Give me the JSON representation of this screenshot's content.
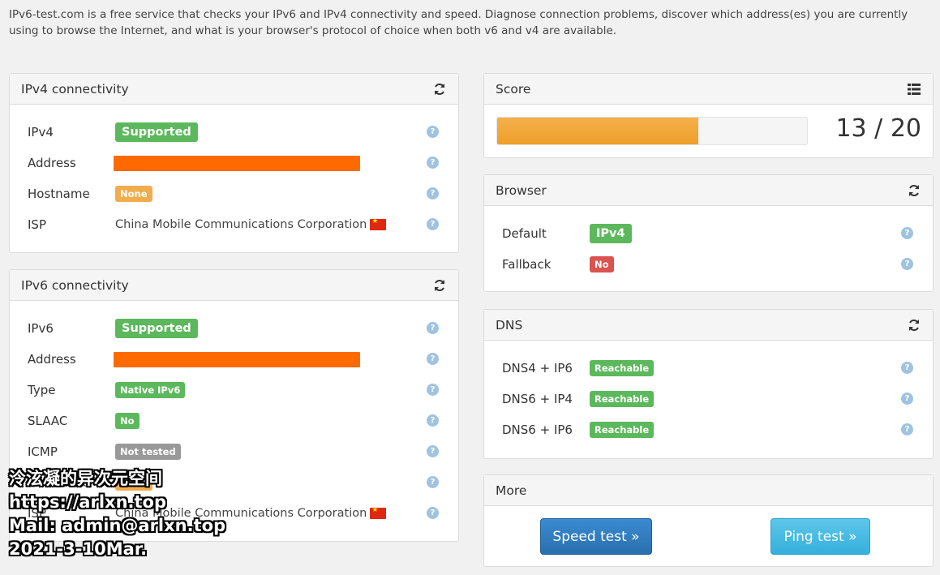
{
  "intro": "IPv6-test.com is a free service that checks your IPv6 and IPv4 connectivity and speed. Diagnose connection problems, discover which address(es) you are currently using to browse the Internet, and what is your browser's protocol of choice when both v6 and v4 are available.",
  "ipv4": {
    "title": "IPv4 connectivity",
    "refresh_icon": "refresh-icon",
    "rows": [
      {
        "label": "IPv4",
        "value": "Supported"
      },
      {
        "label": "Address",
        "value": ""
      },
      {
        "label": "Hostname",
        "value": "None"
      },
      {
        "label": "ISP",
        "value": "China Mobile Communications Corporation"
      }
    ]
  },
  "ipv6": {
    "title": "IPv6 connectivity",
    "refresh_icon": "refresh-icon",
    "rows": [
      {
        "label": "IPv6",
        "value": "Supported"
      },
      {
        "label": "Address",
        "value": ""
      },
      {
        "label": "Type",
        "value": "Native IPv6"
      },
      {
        "label": "SLAAC",
        "value": "No"
      },
      {
        "label": "ICMP",
        "value": "Not tested"
      },
      {
        "label": "Hostname",
        "value": "None"
      },
      {
        "label": "ISP",
        "value": "China Mobile Communications Corporation"
      }
    ]
  },
  "score": {
    "title": "Score",
    "list_icon": "list-icon",
    "value": 13,
    "max": 20,
    "text": "13 / 20"
  },
  "browser": {
    "title": "Browser",
    "refresh_icon": "refresh-icon",
    "rows": [
      {
        "label": "Default",
        "value": "IPv4"
      },
      {
        "label": "Fallback",
        "value": "No"
      }
    ]
  },
  "dns": {
    "title": "DNS",
    "refresh_icon": "refresh-icon",
    "rows": [
      {
        "label": "DNS4 + IP6",
        "value": "Reachable"
      },
      {
        "label": "DNS6 + IP4",
        "value": "Reachable"
      },
      {
        "label": "DNS6 + IP6",
        "value": "Reachable"
      }
    ]
  },
  "more": {
    "title": "More",
    "speed_test": "Speed test »",
    "ping_test": "Ping test »"
  },
  "help_glyph": "?",
  "watermark": {
    "line1": "泠泫凝的异次元空间",
    "line2": "https://arlxn.top",
    "line3": "Mail: admin@arlxn.top",
    "line4": "2021-3-10Mar."
  },
  "colors": {
    "success": "#5cb85c",
    "warning": "#f0ad4e",
    "danger": "#d9534f",
    "muted": "#999999",
    "redaction": "#ff6a00",
    "score_bar": "#ee9f2a"
  }
}
